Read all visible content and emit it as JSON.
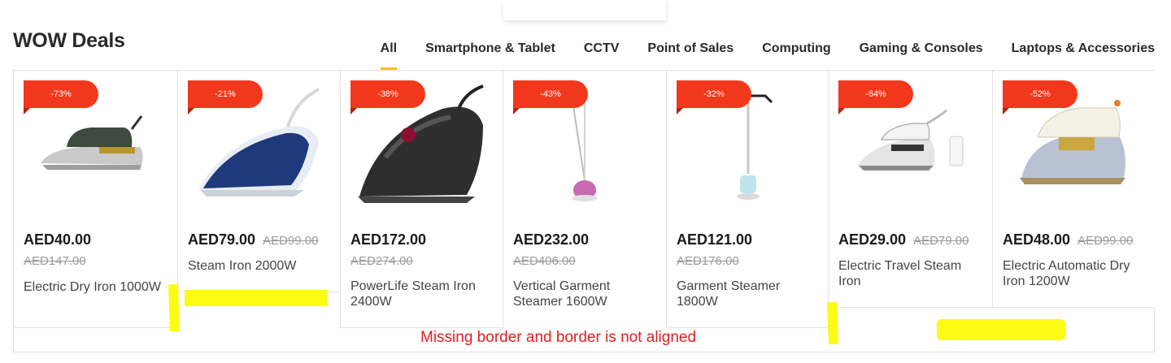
{
  "section": {
    "title": "WOW Deals"
  },
  "tabs": [
    {
      "label": "All"
    },
    {
      "label": "Smartphone & Tablet"
    },
    {
      "label": "CCTV"
    },
    {
      "label": "Point of Sales"
    },
    {
      "label": "Computing"
    },
    {
      "label": "Gaming & Consoles"
    },
    {
      "label": "Laptops & Accessories"
    }
  ],
  "products": [
    {
      "discount": "-73%",
      "price": "AED40.00",
      "old_price": "AED147.00",
      "name": "Electric Dry Iron 1000W"
    },
    {
      "discount": "-21%",
      "price": "AED79.00",
      "old_price": "AED99.00",
      "name": "Steam Iron 2000W"
    },
    {
      "discount": "-38%",
      "price": "AED172.00",
      "old_price": "AED274.00",
      "name": "PowerLife Steam Iron 2400W"
    },
    {
      "discount": "-43%",
      "price": "AED232.00",
      "old_price": "AED406.00",
      "name": "Vertical Garment Steamer 1600W"
    },
    {
      "discount": "-32%",
      "price": "AED121.00",
      "old_price": "AED176.00",
      "name": "Garment Steamer 1800W"
    },
    {
      "discount": "-64%",
      "price": "AED29.00",
      "old_price": "AED79.00",
      "name": "Electric Travel Steam Iron"
    },
    {
      "discount": "-52%",
      "price": "AED48.00",
      "old_price": "AED99.00",
      "name": "Electric Automatic Dry Iron 1200W"
    }
  ],
  "annotation": {
    "note": "Missing border and border is not aligned"
  },
  "colors": {
    "badge": "#f2381c",
    "active_tab": "#f5c400",
    "annotation": "#e02020",
    "highlight": "#fbfb14"
  }
}
